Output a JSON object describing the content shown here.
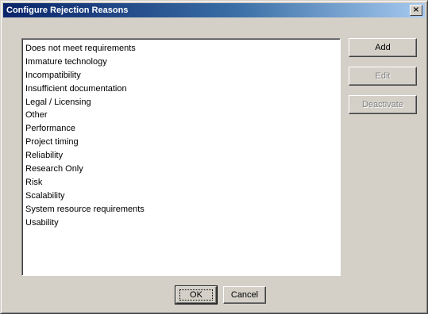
{
  "window": {
    "title": "Configure Rejection Reasons",
    "close_label": "×"
  },
  "reasons": [
    "Does not meet requirements",
    "Immature technology",
    "Incompatibility",
    "Insufficient documentation",
    "Legal / Licensing",
    "Other",
    "Performance",
    "Project timing",
    "Reliability",
    "Research Only",
    "Risk",
    "Scalability",
    "System resource requirements",
    "Usability"
  ],
  "buttons": {
    "add": "Add",
    "edit": "Edit",
    "deactivate": "Deactivate",
    "ok": "OK",
    "cancel": "Cancel"
  },
  "colors": {
    "title_start": "#0a246a",
    "title_end": "#a6caf0",
    "face": "#d4d0c8"
  }
}
